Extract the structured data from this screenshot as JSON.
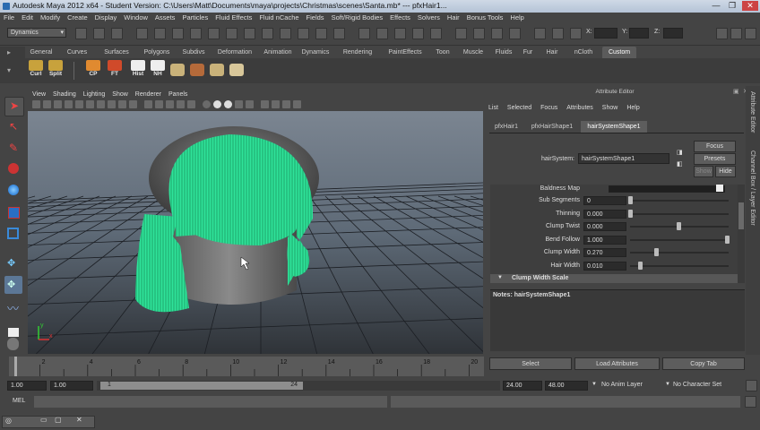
{
  "window": {
    "title": "Autodesk Maya 2012 x64 - Student Version: C:\\Users\\Matt\\Documents\\maya\\projects\\Christmas\\scenes\\Santa.mb*  ---  pfxHair1...",
    "minimize": "—",
    "restore": "❐",
    "close": "✕"
  },
  "menu": [
    "File",
    "Edit",
    "Modify",
    "Create",
    "Display",
    "Window",
    "Assets",
    "Particles",
    "Fluid Effects",
    "Fluid nCache",
    "Fields",
    "Soft/Rigid Bodies",
    "Effects",
    "Solvers",
    "Hair",
    "Bonus Tools",
    "Help"
  ],
  "status": {
    "menuset": "Dynamics",
    "x_label": "X:",
    "y_label": "Y:",
    "z_label": "Z:"
  },
  "shelf": {
    "tabs": [
      "General",
      "Curves",
      "Surfaces",
      "Polygons",
      "Subdivs",
      "Deformation",
      "Animation",
      "Dynamics",
      "Rendering",
      "PaintEffects",
      "Toon",
      "Muscle",
      "Fluids",
      "Fur",
      "Hair",
      "nCloth",
      "Custom"
    ],
    "active_tab": "Custom",
    "icons": [
      "Curl",
      "Split",
      "CP",
      "FT",
      "Hist",
      "NH"
    ]
  },
  "viewport": {
    "menu": [
      "View",
      "Shading",
      "Lighting",
      "Show",
      "Renderer",
      "Panels"
    ],
    "axis_y": "y",
    "axis_x": "x"
  },
  "attribute_editor": {
    "title": "Attribute Editor",
    "menu": [
      "List",
      "Selected",
      "Focus",
      "Attributes",
      "Show",
      "Help"
    ],
    "tabs": [
      "pfxHair1",
      "pfxHairShape1",
      "hairSystemShape1"
    ],
    "active_tab": "hairSystemShape1",
    "node_label": "hairSystem:",
    "node_value": "hairSystemShape1",
    "focus": "Focus",
    "presets": "Presets",
    "show": "Show",
    "hide": "Hide",
    "baldness_label": "Baldness Map",
    "rows": [
      {
        "label": "Sub Segments",
        "value": "0",
        "level": 0.0
      },
      {
        "label": "Thinning",
        "value": "0.000",
        "level": 0.0
      },
      {
        "label": "Clump Twist",
        "value": "0.000",
        "level": 0.5
      },
      {
        "label": "Bend Follow",
        "value": "1.000",
        "level": 1.0
      },
      {
        "label": "Clump Width",
        "value": "0.270",
        "level": 0.27
      },
      {
        "label": "Hair Width",
        "value": "0.010",
        "level": 0.1
      }
    ],
    "section": "Clump Width Scale",
    "notes": "Notes:  hairSystemShape1",
    "select": "Select",
    "load": "Load Attributes",
    "copy": "Copy Tab",
    "side_tabs": [
      "Attribute Editor",
      "Channel Box / Layer Editor"
    ]
  },
  "timeline": {
    "ticks": [
      "2",
      "4",
      "6",
      "8",
      "10",
      "12",
      "14",
      "16",
      "18",
      "20"
    ]
  },
  "range": {
    "start": "1.00",
    "playstart": "1.00",
    "current": "1",
    "rangeend": "24",
    "end": "24.00",
    "playend": "48.00",
    "anim_layer": "No Anim Layer",
    "char_set": "No Character Set"
  },
  "command": {
    "label": "MEL"
  }
}
